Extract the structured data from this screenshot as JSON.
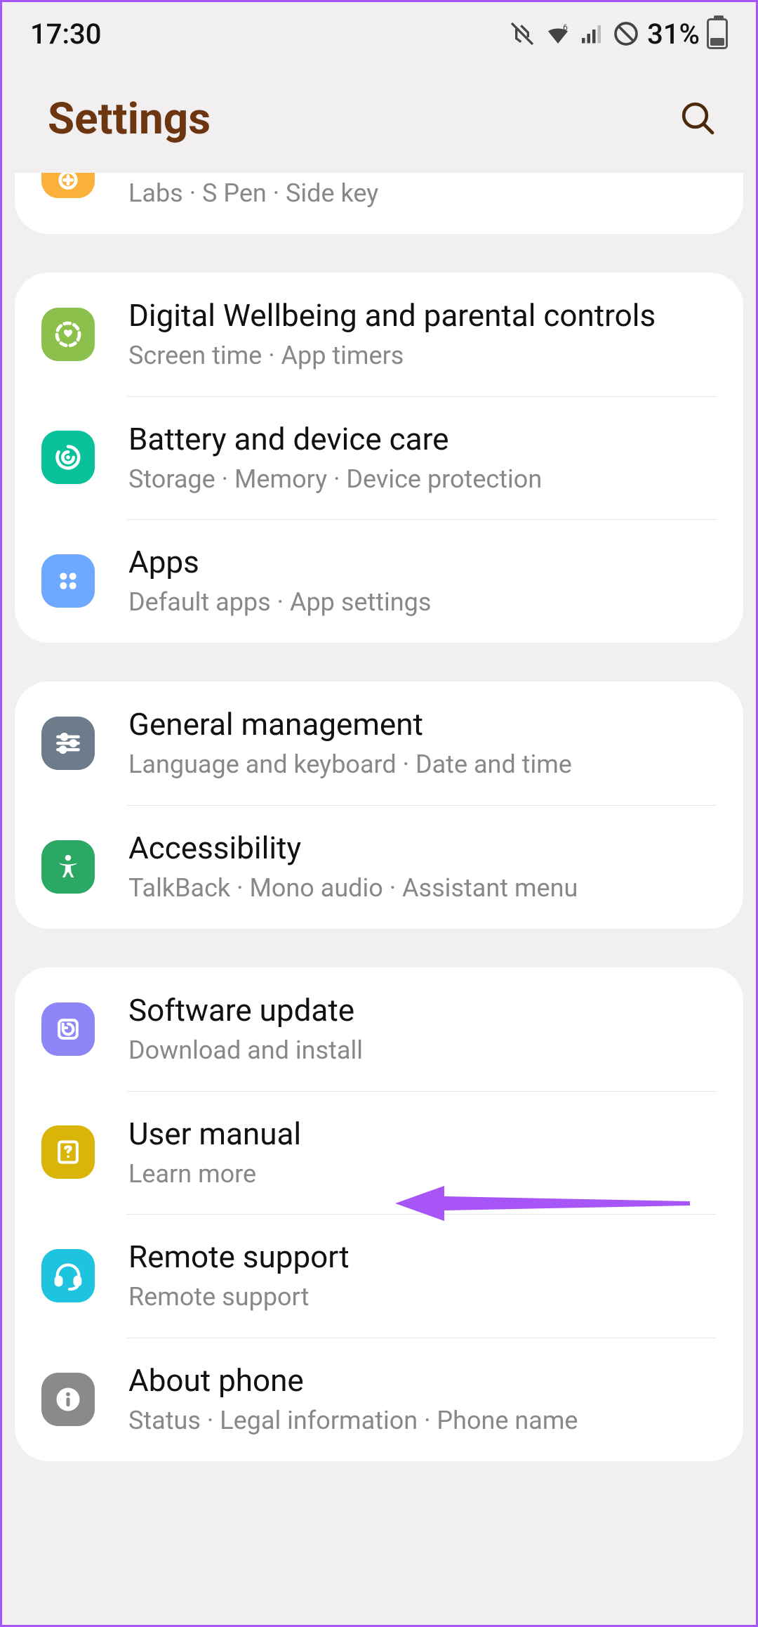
{
  "status": {
    "time": "17:30",
    "battery": "31%"
  },
  "header": {
    "title": "Settings"
  },
  "groups": {
    "advanced_partial": {
      "subtitle": "Labs  ·  S Pen  ·  Side key"
    },
    "wellbeing": {
      "title": "Digital Wellbeing and parental controls",
      "subtitle": "Screen time  ·  App timers"
    },
    "battery_care": {
      "title": "Battery and device care",
      "subtitle": "Storage  ·  Memory  ·  Device protection"
    },
    "apps": {
      "title": "Apps",
      "subtitle": "Default apps  ·  App settings"
    },
    "general": {
      "title": "General management",
      "subtitle": "Language and keyboard  ·  Date and time"
    },
    "accessibility": {
      "title": "Accessibility",
      "subtitle": "TalkBack  ·  Mono audio  ·  Assistant menu"
    },
    "software": {
      "title": "Software update",
      "subtitle": "Download and install"
    },
    "manual": {
      "title": "User manual",
      "subtitle": "Learn more"
    },
    "remote": {
      "title": "Remote support",
      "subtitle": "Remote support"
    },
    "about": {
      "title": "About phone",
      "subtitle": "Status  ·  Legal information  ·  Phone name"
    }
  },
  "colors": {
    "advanced": "#fab23c",
    "wellbeing": "#8cc04c",
    "battery_care": "#0ac29a",
    "apps": "#6ea8ff",
    "general": "#6d7b8a",
    "accessibility": "#2ba863",
    "software": "#8e86f7",
    "manual": "#d9b507",
    "remote": "#1ec3de",
    "about": "#8a8a8a"
  }
}
